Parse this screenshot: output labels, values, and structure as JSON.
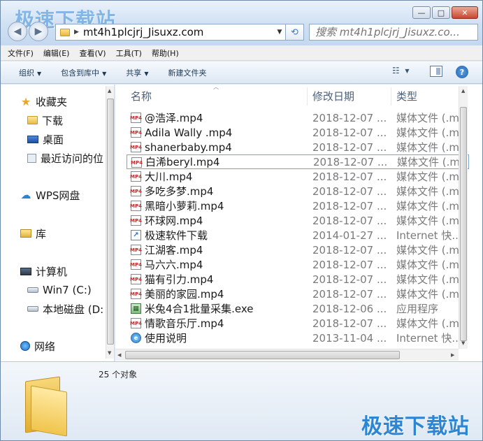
{
  "watermark": "极速下载站",
  "window": {
    "buttons": {
      "minimize": "—",
      "maximize": "□",
      "close": "✕"
    }
  },
  "address": {
    "path": "mt4h1plcjrj_Jisuxz.com"
  },
  "search": {
    "placeholder": "搜索 mt4h1plcjrj_Jisuxz.co..."
  },
  "menu": [
    "文件(F)",
    "编辑(E)",
    "查看(V)",
    "工具(T)",
    "帮助(H)"
  ],
  "toolbar": {
    "organize": "组织",
    "include_library": "包含到库中",
    "share": "共享",
    "new_folder": "新建文件夹"
  },
  "nav": {
    "favorites": "收藏夹",
    "downloads": "下载",
    "desktop": "桌面",
    "recent": "最近访问的位",
    "wps": "WPS网盘",
    "library": "库",
    "computer": "计算机",
    "drive_c": "Win7 (C:)",
    "drive_d": "本地磁盘 (D:",
    "network": "网络"
  },
  "columns": {
    "name": "名称",
    "date": "修改日期",
    "type": "类型"
  },
  "files": [
    {
      "name": "@浩泽.mp4",
      "date": "2018-12-07 ...",
      "type": "媒体文件 (.m..",
      "icon": "mp4"
    },
    {
      "name": "Adila Wally .mp4",
      "date": "2018-12-07 ...",
      "type": "媒体文件 (.m..",
      "icon": "mp4"
    },
    {
      "name": "shanerbaby.mp4",
      "date": "2018-12-07 ...",
      "type": "媒体文件 (.m..",
      "icon": "mp4"
    },
    {
      "name": "白浠beryl.mp4",
      "date": "2018-12-07 ...",
      "type": "媒体文件 (.m..",
      "icon": "mp4"
    },
    {
      "name": "大川.mp4",
      "date": "2018-12-07 ...",
      "type": "媒体文件 (.m..",
      "icon": "mp4"
    },
    {
      "name": "多吃多梦.mp4",
      "date": "2018-12-07 ...",
      "type": "媒体文件 (.m..",
      "icon": "mp4"
    },
    {
      "name": "黑暗小萝莉.mp4",
      "date": "2018-12-07 ...",
      "type": "媒体文件 (.m..",
      "icon": "mp4"
    },
    {
      "name": "环球网.mp4",
      "date": "2018-12-07 ...",
      "type": "媒体文件 (.m..",
      "icon": "mp4"
    },
    {
      "name": "极速软件下载",
      "date": "2014-01-27 ...",
      "type": "Internet 快...",
      "icon": "link"
    },
    {
      "name": "江湖客.mp4",
      "date": "2018-12-07 ...",
      "type": "媒体文件 (.m..",
      "icon": "mp4"
    },
    {
      "name": "马六六.mp4",
      "date": "2018-12-07 ...",
      "type": "媒体文件 (.m..",
      "icon": "mp4"
    },
    {
      "name": "猫有引力.mp4",
      "date": "2018-12-07 ...",
      "type": "媒体文件 (.m..",
      "icon": "mp4"
    },
    {
      "name": "美丽的家园.mp4",
      "date": "2018-12-07 ...",
      "type": "媒体文件 (.m..",
      "icon": "mp4"
    },
    {
      "name": "米兔4合1批量采集.exe",
      "date": "2018-12-06 ...",
      "type": "应用程序",
      "icon": "exe"
    },
    {
      "name": "情歌音乐厅.mp4",
      "date": "2018-12-07 ...",
      "type": "媒体文件 (.m..",
      "icon": "mp4"
    },
    {
      "name": "使用说明",
      "date": "2013-11-04 ...",
      "type": "Internet 快...",
      "icon": "url"
    }
  ],
  "status": {
    "count": "25 个对象"
  }
}
